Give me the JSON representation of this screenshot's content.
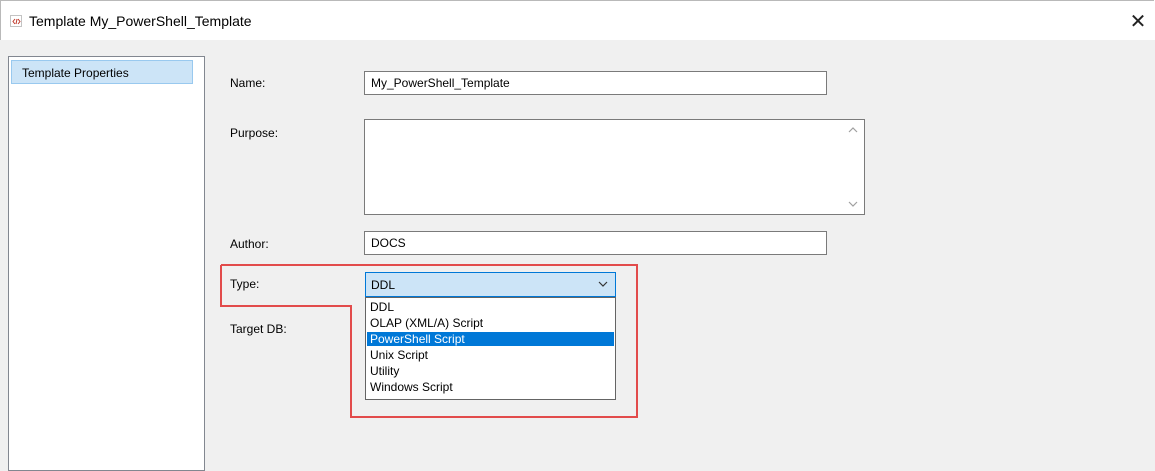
{
  "window": {
    "title": "Template My_PowerShell_Template",
    "close_symbol": "✕"
  },
  "sidebar": {
    "items": [
      {
        "label": "Template Properties",
        "selected": true
      }
    ]
  },
  "form": {
    "name_label": "Name:",
    "name_value": "My_PowerShell_Template",
    "purpose_label": "Purpose:",
    "purpose_value": "",
    "author_label": "Author:",
    "author_value": "DOCS",
    "type_label": "Type:",
    "type_value": "DDL",
    "target_db_label": "Target DB:"
  },
  "type_dropdown": {
    "options": [
      "DDL",
      "OLAP (XML/A) Script",
      "PowerShell Script",
      "Unix Script",
      "Utility",
      "Windows Script"
    ],
    "highlighted_index": 2
  },
  "colors": {
    "accent": "#0078d7",
    "selection_bg": "#cce4f7",
    "annotation": "#e24b4b"
  },
  "icons": {
    "title": "template-code-icon",
    "close": "close-icon",
    "chevron": "chevron-down-icon"
  }
}
